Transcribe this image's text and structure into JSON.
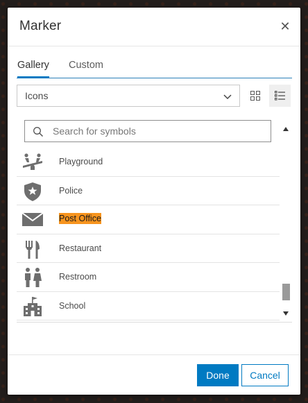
{
  "dialog": {
    "title": "Marker",
    "close_icon": "close-icon"
  },
  "tabs": [
    {
      "label": "Gallery",
      "active": true
    },
    {
      "label": "Custom",
      "active": false
    }
  ],
  "category_select": {
    "selected": "Icons"
  },
  "view_toggle": {
    "grid_icon": "grid-view-icon",
    "list_icon": "list-view-icon",
    "active": "list"
  },
  "search": {
    "placeholder": "Search for symbols",
    "value": ""
  },
  "symbols": [
    {
      "label": "Playground",
      "icon": "playground-icon"
    },
    {
      "label": "Police",
      "icon": "police-icon"
    },
    {
      "label": "Post Office",
      "icon": "post-office-icon",
      "highlighted": true
    },
    {
      "label": "Restaurant",
      "icon": "restaurant-icon"
    },
    {
      "label": "Restroom",
      "icon": "restroom-icon"
    },
    {
      "label": "School",
      "icon": "school-icon"
    }
  ],
  "footer": {
    "done_label": "Done",
    "cancel_label": "Cancel"
  },
  "colors": {
    "accent": "#007ac2",
    "highlight": "#f7941e",
    "icon": "#6e6e6e"
  }
}
